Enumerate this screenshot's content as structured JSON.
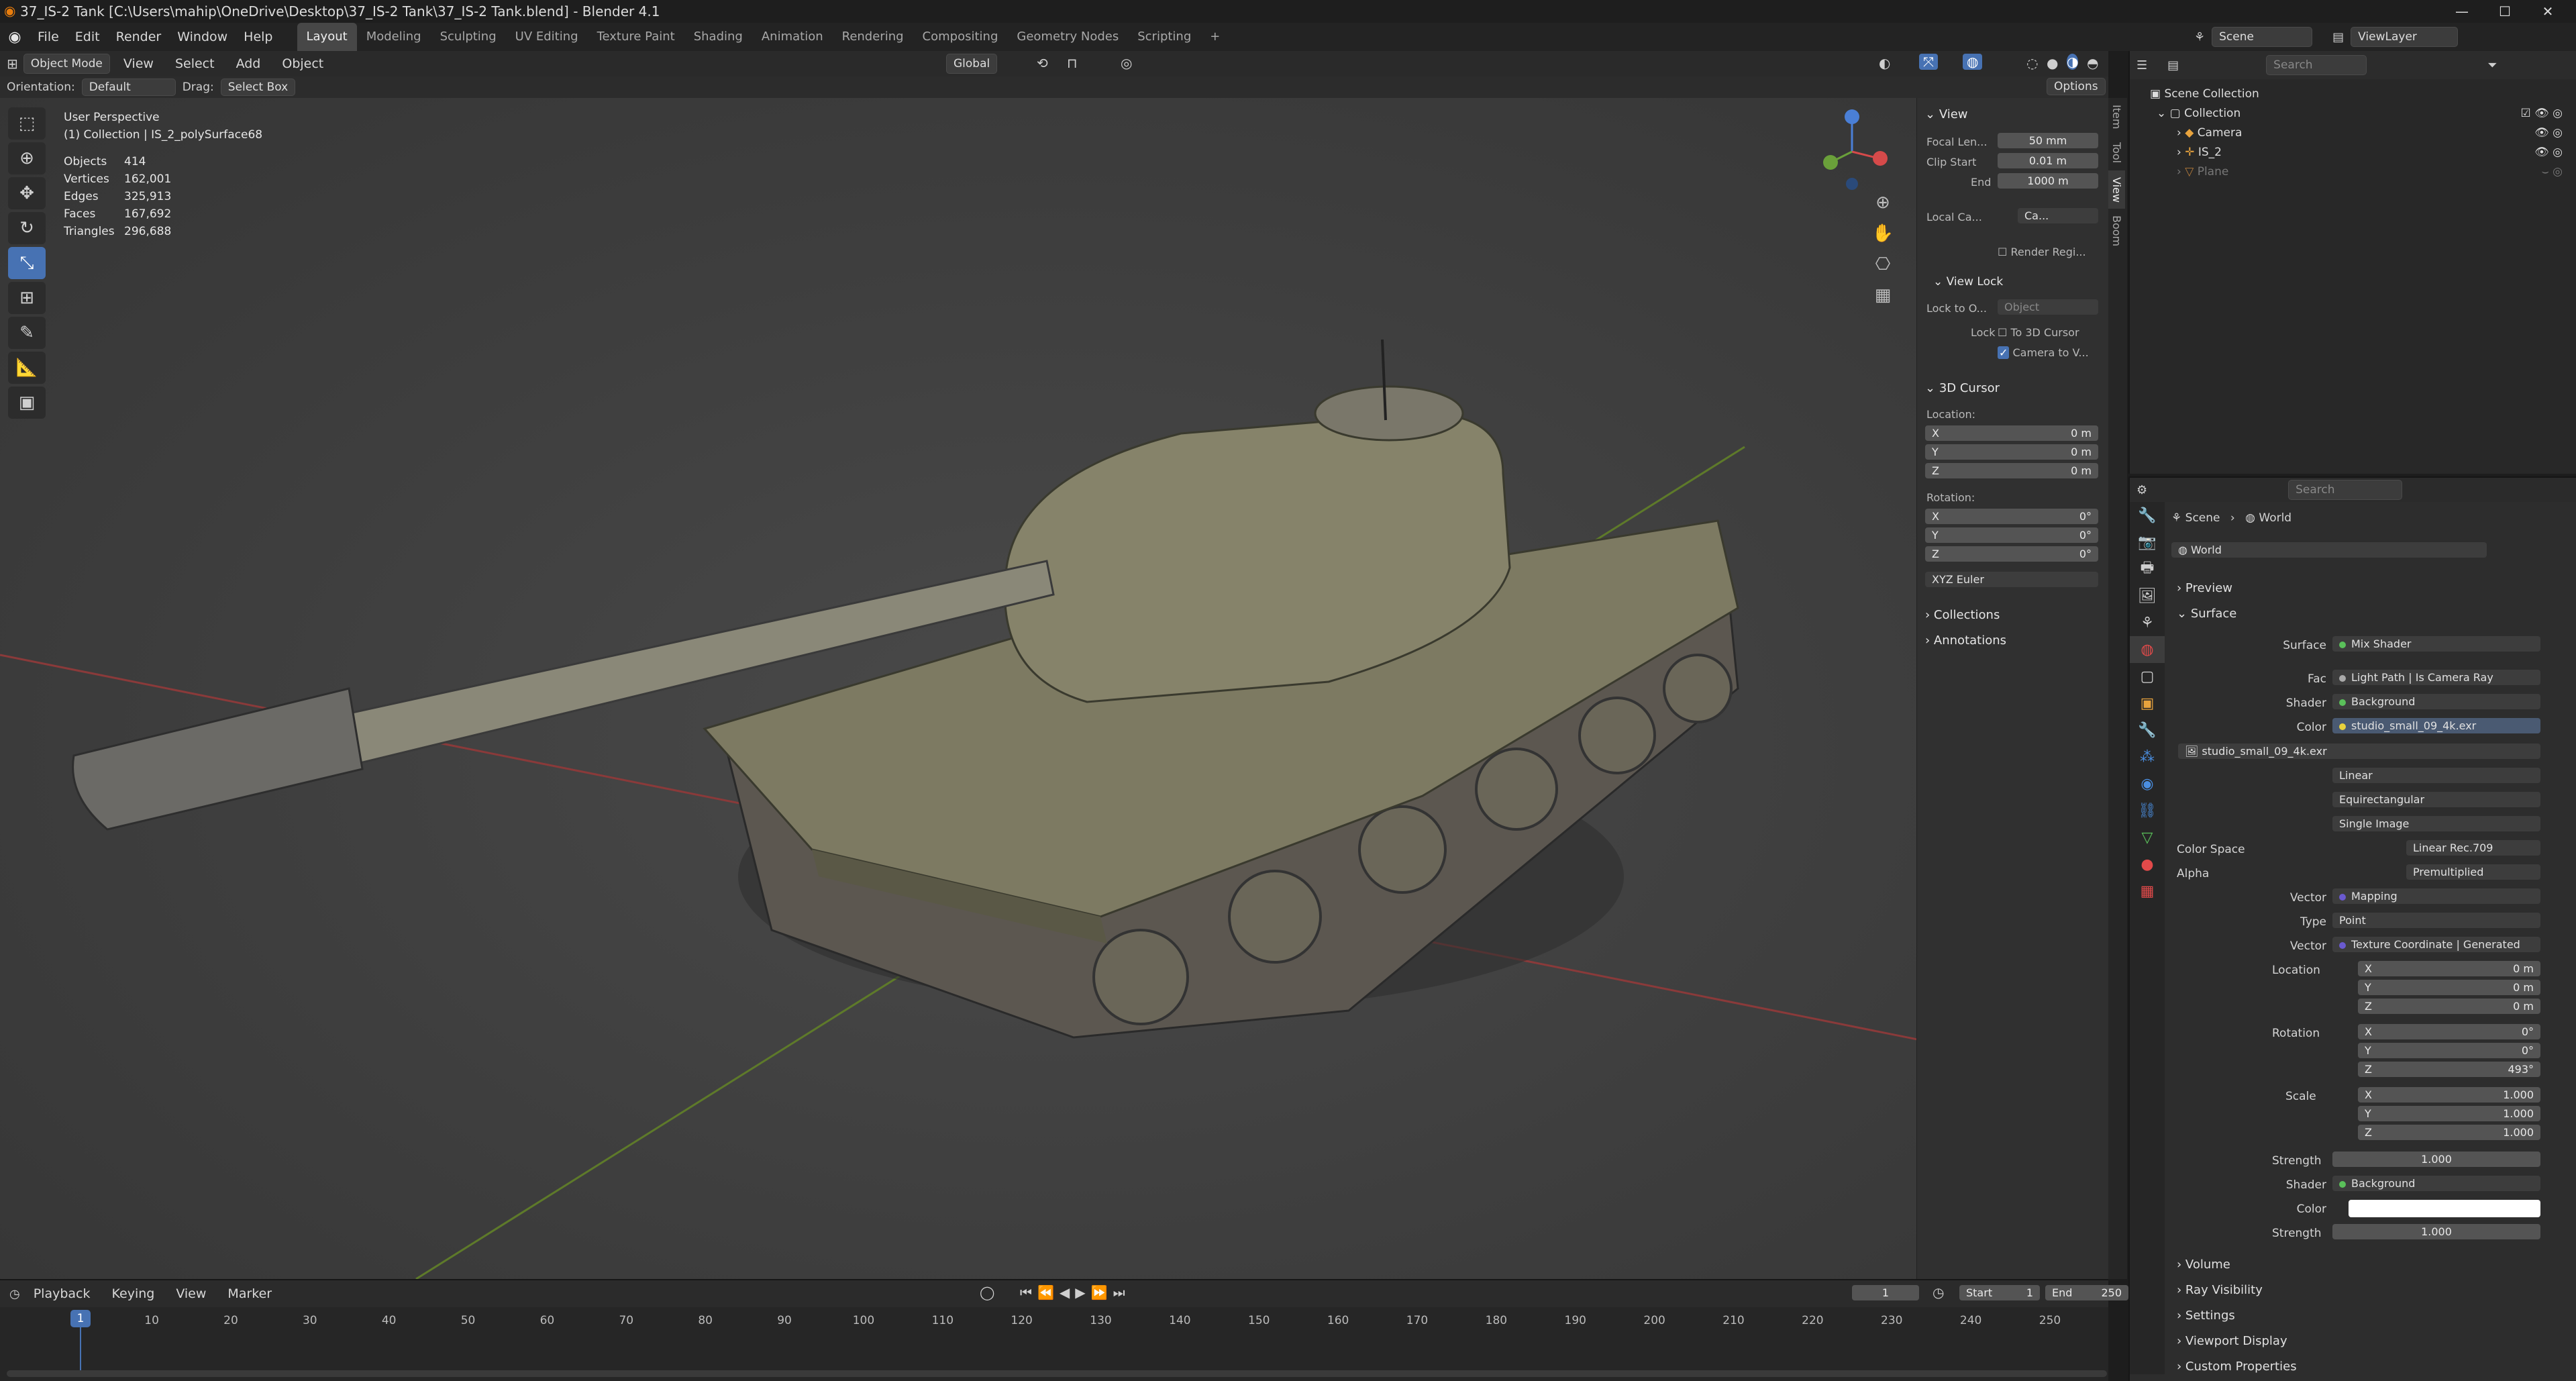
{
  "titlebar": {
    "title": "37_IS-2 Tank [C:\\Users\\mahip\\OneDrive\\Desktop\\37_IS-2 Tank\\37_IS-2 Tank.blend] - Blender 4.1",
    "minimize": "—",
    "maximize": "☐",
    "close": "✕"
  },
  "menu": {
    "file": "File",
    "edit": "Edit",
    "render": "Render",
    "window": "Window",
    "help": "Help"
  },
  "workspaces": [
    "Layout",
    "Modeling",
    "Sculpting",
    "UV Editing",
    "Texture Paint",
    "Shading",
    "Animation",
    "Rendering",
    "Compositing",
    "Geometry Nodes",
    "Scripting",
    "+"
  ],
  "header": {
    "scene": "Scene",
    "viewlayer": "ViewLayer"
  },
  "viewport_header": {
    "mode": "Object Mode",
    "view": "View",
    "select": "Select",
    "add": "Add",
    "object": "Object",
    "transform": "Global",
    "options": "Options",
    "orientation_label": "Orientation:",
    "orientation_value": "Default",
    "drag_label": "Drag:",
    "drag_value": "Select Box"
  },
  "viewport": {
    "perspective": "User Perspective",
    "collection": "(1) Collection | IS_2_polySurface68",
    "stats": [
      {
        "k": "Objects",
        "v": "414"
      },
      {
        "k": "Vertices",
        "v": "162,001"
      },
      {
        "k": "Edges",
        "v": "325,913"
      },
      {
        "k": "Faces",
        "v": "167,692"
      },
      {
        "k": "Triangles",
        "v": "296,688"
      }
    ]
  },
  "npanel": {
    "view_title": "View",
    "focal_label": "Focal Len...",
    "focal_value": "50 mm",
    "clip_start_label": "Clip Start",
    "clip_start_value": "0.01 m",
    "end_label": "End",
    "end_value": "1000 m",
    "local_cam_label": "Local Ca...",
    "local_cam_value": "Ca...",
    "render_region": "Render Regi...",
    "view_lock_title": "View Lock",
    "lock_to_label": "Lock to O...",
    "lock_to_value": "Object",
    "lock_label": "Lock",
    "to_cursor": "To 3D Cursor",
    "cam_to_view": "Camera to V...",
    "cursor_title": "3D Cursor",
    "location_label": "Location:",
    "rotation_label": "Rotation:",
    "loc_x": "0 m",
    "loc_y": "0 m",
    "loc_z": "0 m",
    "rot_x": "0°",
    "rot_y": "0°",
    "rot_z": "0°",
    "x": "X",
    "y": "Y",
    "z": "Z",
    "euler": "XYZ Euler",
    "collections": "Collections",
    "annotations": "Annotations",
    "tabs": [
      "Item",
      "Tool",
      "View",
      "Boom"
    ]
  },
  "outliner": {
    "search_placeholder": "Search",
    "scene_collection": "Scene Collection",
    "collection": "Collection",
    "camera": "Camera",
    "is2": "IS_2",
    "plane": "Plane"
  },
  "properties": {
    "search_placeholder": "Search",
    "breadcrumb_scene": "Scene",
    "breadcrumb_world": "World",
    "world_name": "World",
    "preview": "Preview",
    "surface": "Surface",
    "surface_label": "Surface",
    "surface_value": "Mix Shader",
    "fac_label": "Fac",
    "fac_value": "Light Path | Is Camera Ray",
    "shader_label": "Shader",
    "shader_value": "Background",
    "color_label": "Color",
    "color_value": "studio_small_09_4k.exr",
    "image_name": "studio_small_09_4k.exr",
    "interp": "Linear",
    "projection": "Equirectangular",
    "source": "Single Image",
    "colorspace_label": "Color Space",
    "colorspace_value": "Linear Rec.709",
    "alpha_label": "Alpha",
    "alpha_value": "Premultiplied",
    "vector_label": "Vector",
    "vector_value": "Mapping",
    "type_label": "Type",
    "type_value": "Point",
    "vector2_value": "Texture Coordinate | Generated",
    "location_label": "Location",
    "rotation_label": "Rotation",
    "scale_label": "Scale",
    "loc": [
      "0 m",
      "0 m",
      "0 m"
    ],
    "rot": [
      "0°",
      "0°",
      "493°"
    ],
    "scl": [
      "1.000",
      "1.000",
      "1.000"
    ],
    "x": "X",
    "y": "Y",
    "z": "Z",
    "strength_label": "Strength",
    "strength_value": "1.000",
    "shader2_value": "Background",
    "color2_label": "Color",
    "strength2_value": "1.000",
    "volume": "Volume",
    "ray_visibility": "Ray Visibility",
    "settings": "Settings",
    "viewport_display": "Viewport Display",
    "custom_props": "Custom Properties"
  },
  "timeline": {
    "playback": "Playback",
    "keying": "Keying",
    "view": "View",
    "marker": "Marker",
    "current_frame": "1",
    "start_label": "Start",
    "start_value": "1",
    "end_label": "End",
    "end_value": "250",
    "ticks": [
      "10",
      "20",
      "30",
      "40",
      "50",
      "60",
      "70",
      "80",
      "90",
      "100",
      "110",
      "120",
      "130",
      "140",
      "150",
      "160",
      "170",
      "180",
      "190",
      "200",
      "210",
      "220",
      "230",
      "240",
      "250"
    ],
    "playhead": "1"
  },
  "colors": {
    "accent": "#4772b3",
    "bg": "#1d1d1d",
    "viewport": "#3e3e3e"
  }
}
